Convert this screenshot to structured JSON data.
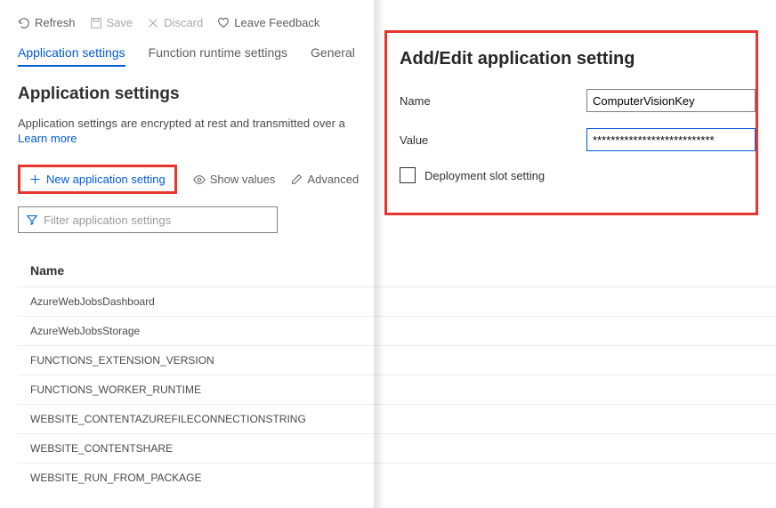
{
  "toolbar": {
    "refresh": "Refresh",
    "save": "Save",
    "discard": "Discard",
    "feedback": "Leave Feedback"
  },
  "tabs": {
    "app_settings": "Application settings",
    "runtime": "Function runtime settings",
    "general": "General"
  },
  "section": {
    "title": "Application settings",
    "desc": "Application settings are encrypted at rest and transmitted over a",
    "learn": "Learn more"
  },
  "actions": {
    "new_setting": "New application setting",
    "show_values": "Show values",
    "advanced": "Advanced"
  },
  "filter_placeholder": "Filter application settings",
  "table": {
    "header": "Name",
    "rows": [
      "AzureWebJobsDashboard",
      "AzureWebJobsStorage",
      "FUNCTIONS_EXTENSION_VERSION",
      "FUNCTIONS_WORKER_RUNTIME",
      "WEBSITE_CONTENTAZUREFILECONNECTIONSTRING",
      "WEBSITE_CONTENTSHARE",
      "WEBSITE_RUN_FROM_PACKAGE"
    ]
  },
  "panel": {
    "title": "Add/Edit application setting",
    "name_label": "Name",
    "name_value": "ComputerVisionKey",
    "value_label": "Value",
    "value_value": "***************************",
    "slot_label": "Deployment slot setting"
  }
}
